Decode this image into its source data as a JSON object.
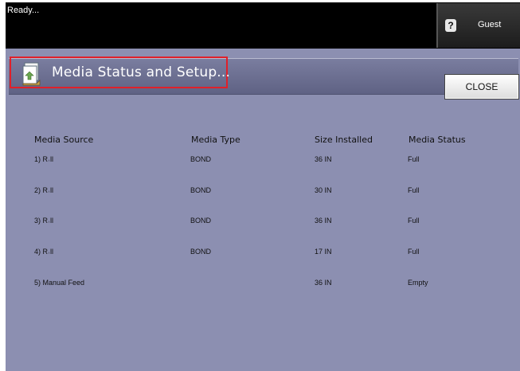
{
  "status_bar": {
    "ready_text": "Ready...",
    "user_label": "Guest",
    "user_icon": "user-unknown-icon"
  },
  "dialog": {
    "title": "Media Status and Setup...",
    "title_icon": "media-tray-icon",
    "close_label": "CLOSE"
  },
  "table": {
    "headers": [
      "Media Source",
      "Media Type",
      "Size Installed",
      "Media Status"
    ],
    "rows": [
      {
        "source": "1)  R˓ll",
        "type": "BOND",
        "size": "36 IN",
        "status": "Full"
      },
      {
        "source": "2)  R˓ll",
        "type": "BOND",
        "size": "30 IN",
        "status": "Full"
      },
      {
        "source": "3)  R˓ll",
        "type": "BOND",
        "size": "36 IN",
        "status": "Full"
      },
      {
        "source": "4)  R˓ll",
        "type": "BOND",
        "size": "17 IN",
        "status": "Full"
      },
      {
        "source": "5)  Manual Feed",
        "type": "",
        "size": "36 IN",
        "status": "Empty"
      }
    ]
  },
  "colors": {
    "panel": "#8c8fb1",
    "header": "#6c6f91",
    "highlight": "#e0202a",
    "topbar": "#000000"
  }
}
